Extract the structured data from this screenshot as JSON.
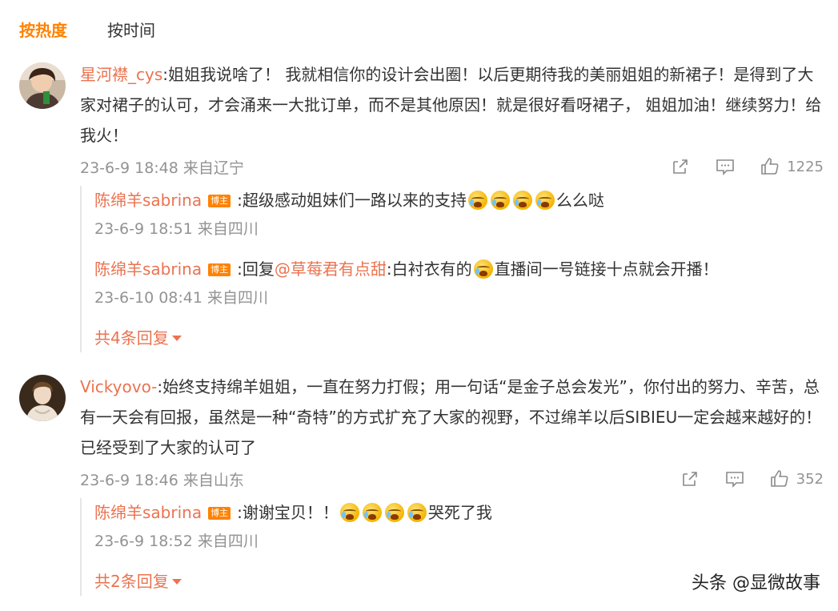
{
  "tabs": [
    "按热度",
    "按时间"
  ],
  "colors": {
    "accent": "#ff8200",
    "username": "#eb7350",
    "meta": "#939393"
  },
  "comments": [
    {
      "user": "星河襟_cys",
      "text": ":姐姐我说啥了！ 我就相信你的设计会出圈！以后更期待我的美丽姐姐的新裙子！是得到了大家对裙子的认可，才会涌来一大批订单，而不是其他原因！就是很好看呀裙子， 姐姐加油！继续努力！给我火！",
      "meta": "23-6-9 18:48 来自辽宁",
      "likes": "1225",
      "replies": [
        {
          "user": "陈绵羊sabrina",
          "badge": "博主",
          "text_before": ":超级感动姐妹们一路以来的支持",
          "emoji_count": 4,
          "text_after": "么么哒",
          "meta": "23-6-9 18:51 来自四川"
        },
        {
          "user": "陈绵羊sabrina",
          "badge": "博主",
          "prefix": ":回复",
          "mention": "@草莓君有点甜",
          "text_before": ":白衬衣有的",
          "emoji_count": 1,
          "text_after": "直播间一号链接十点就会开播！",
          "meta": "23-6-10 08:41 来自四川"
        }
      ],
      "more": "共4条回复"
    },
    {
      "user": "Vickyovo-",
      "text": ":始终支持绵羊姐姐，一直在努力打假；用一句话“是金子总会发光”，你付出的努力、辛苦，总有一天会有回报，虽然是一种“奇特”的方式扩充了大家的视野，不过绵羊以后SIBIEU一定会越来越好的！已经受到了大家的认可了",
      "meta": "23-6-9 18:46 来自山东",
      "likes": "352",
      "replies": [
        {
          "user": "陈绵羊sabrina",
          "badge": "博主",
          "text_before": ":谢谢宝贝！！",
          "emoji_count": 4,
          "text_after": "哭死了我",
          "meta": "23-6-9 18:52 来自四川"
        }
      ],
      "more": "共2条回复"
    }
  ],
  "watermark": "头条 @显微故事"
}
